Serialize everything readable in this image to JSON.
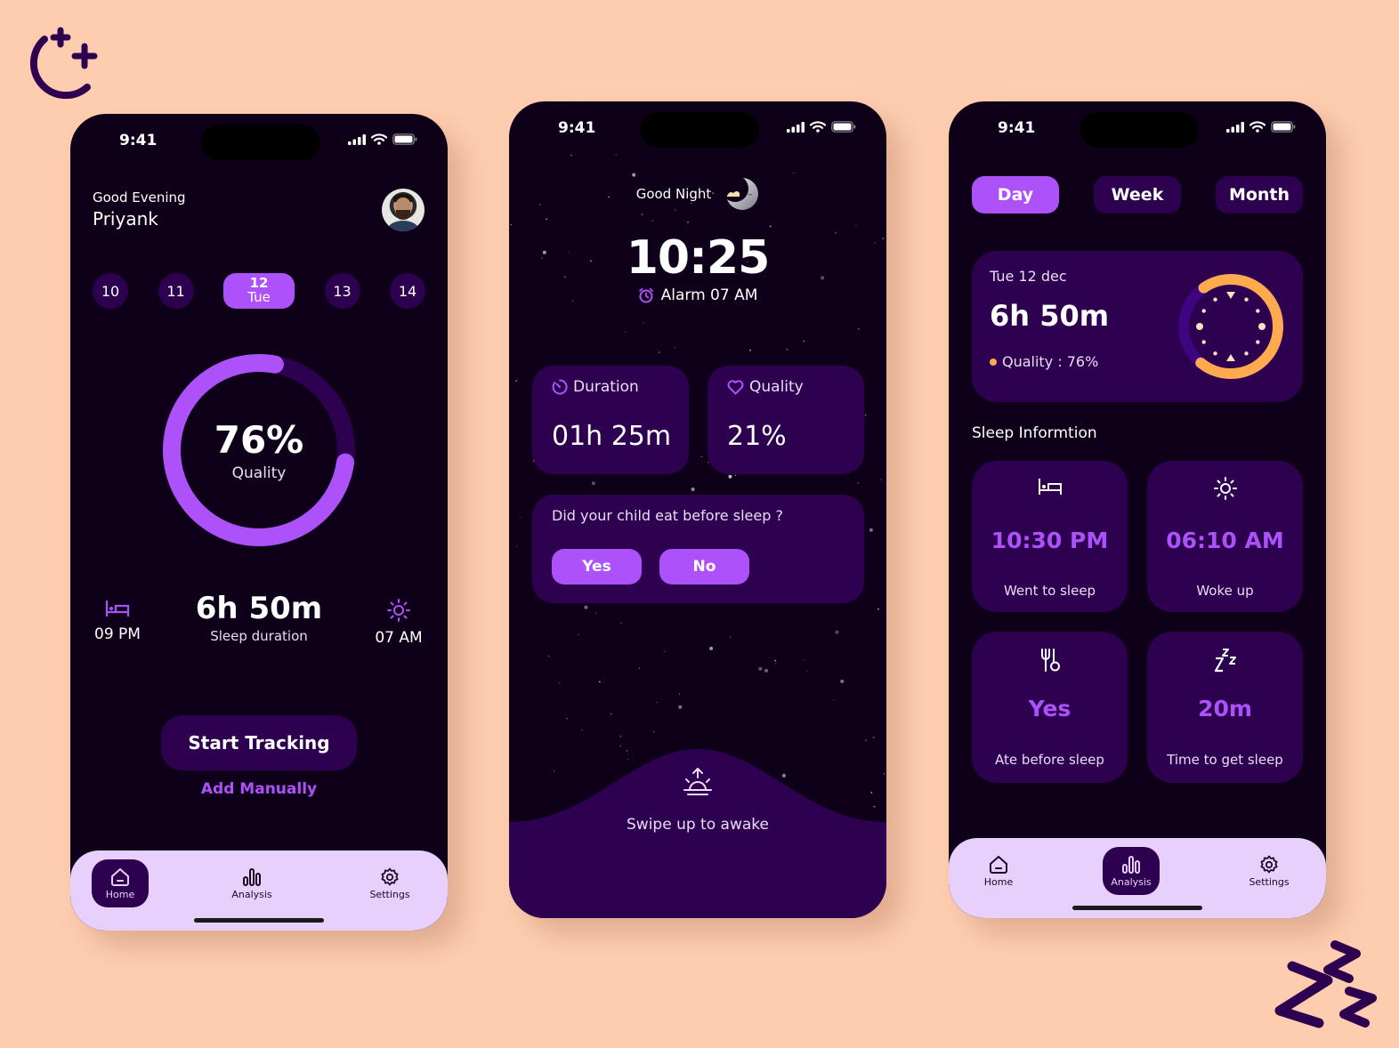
{
  "colors": {
    "background": "#fecdb0",
    "screen": "#0e0019",
    "card": "#2d0150",
    "accent": "#ad52fb",
    "nav_bg": "#e8d0fd",
    "orange": "#ffaa4f",
    "deco": "#2d0150"
  },
  "decorations": {
    "top_left_icon": "moon-stars-icon",
    "bottom_right_icon": "zzz-icon"
  },
  "status_bar": {
    "time": "9:41"
  },
  "home_screen": {
    "greeting": "Good Evening",
    "user_name": "Priyank",
    "days": [
      {
        "number": "10",
        "weekday": ""
      },
      {
        "number": "11",
        "weekday": ""
      },
      {
        "number": "12",
        "weekday": "Tue",
        "selected": true
      },
      {
        "number": "13",
        "weekday": ""
      },
      {
        "number": "14",
        "weekday": ""
      }
    ],
    "quality_percent": 76,
    "quality_value": "76%",
    "quality_label": "Quality",
    "bed_time": "09 PM",
    "wake_time": "07 AM",
    "sleep_duration": "6h 50m",
    "sleep_duration_label": "Sleep duration",
    "start_button": "Start Tracking",
    "add_manually": "Add Manually",
    "nav": [
      {
        "label": "Home",
        "icon": "home-icon",
        "active": true
      },
      {
        "label": "Analysis",
        "icon": "bar-chart-icon",
        "active": false
      },
      {
        "label": "Settings",
        "icon": "gear-icon",
        "active": false
      }
    ]
  },
  "tracking_screen": {
    "greeting": "Good Night",
    "clock": "10:25",
    "alarm": "Alarm 07 AM",
    "duration_label": "Duration",
    "duration_value": "01h 25m",
    "quality_label": "Quality",
    "quality_value": "21%",
    "question": "Did your child eat before sleep ?",
    "yes_button": "Yes",
    "no_button": "No",
    "swipe_text": "Swipe up to awake"
  },
  "analysis_screen": {
    "tabs": [
      {
        "label": "Day",
        "active": true
      },
      {
        "label": "Week",
        "active": false
      },
      {
        "label": "Month",
        "active": false
      }
    ],
    "summary": {
      "date": "Tue 12 dec",
      "duration": "6h 50m",
      "quality": "Quality : 76%",
      "quality_percent": 76
    },
    "section_title": "Sleep Informtion",
    "tiles": [
      {
        "icon": "bed-icon",
        "value": "10:30 PM",
        "label": "Went to sleep"
      },
      {
        "icon": "sun-icon",
        "value": "06:10 AM",
        "label": "Woke up"
      },
      {
        "icon": "fork-spoon-icon",
        "value": "Yes",
        "label": "Ate before sleep"
      },
      {
        "icon": "zzz-icon",
        "value": "20m",
        "label": "Time to get sleep"
      }
    ],
    "nav": [
      {
        "label": "Home",
        "icon": "home-icon",
        "active": false
      },
      {
        "label": "Analysis",
        "icon": "bar-chart-icon",
        "active": true
      },
      {
        "label": "Settings",
        "icon": "gear-icon",
        "active": false
      }
    ]
  }
}
